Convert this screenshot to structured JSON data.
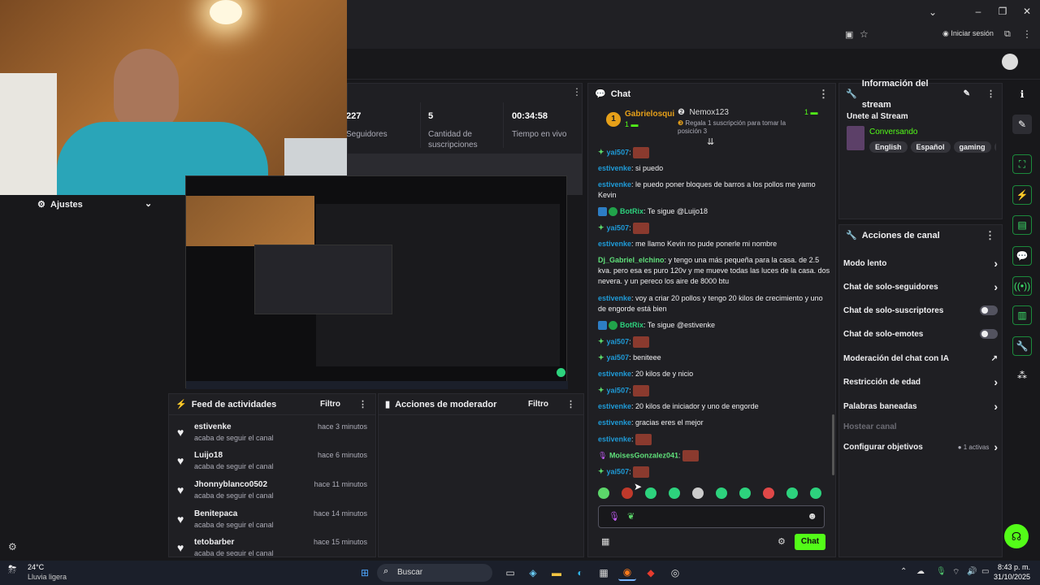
{
  "browser": {
    "signin_label": "Iniciar sesión"
  },
  "stats": [
    {
      "value": "227",
      "label": "Seguidores"
    },
    {
      "value": "5",
      "label": "Cantidad de suscripciones"
    },
    {
      "value": "00:34:58",
      "label": "Tiempo en vivo"
    }
  ],
  "left_nav": {
    "settings_label": "Ajustes"
  },
  "activity_feed": {
    "title": "Feed de actividades",
    "filter": "Filtro",
    "items": [
      {
        "user": "estivenke",
        "action": "acaba de seguir el canal",
        "time": "hace 3 minutos"
      },
      {
        "user": "Luijo18",
        "action": "acaba de seguir el canal",
        "time": "hace 6 minutos"
      },
      {
        "user": "Jhonnyblanco0502",
        "action": "acaba de seguir el canal",
        "time": "hace 11 minutos"
      },
      {
        "user": "Benitepaca",
        "action": "acaba de seguir el canal",
        "time": "hace 14 minutos"
      },
      {
        "user": "tetobarber",
        "action": "acaba de seguir el canal",
        "time": "hace 15 minutos"
      }
    ]
  },
  "mod_actions": {
    "title": "Acciones de moderador",
    "filter": "Filtro"
  },
  "chat": {
    "title": "Chat",
    "leader_name": "Gabrielosqui",
    "leader_count": "1",
    "gift_user": "Nemox123",
    "gift_text": "Regala 1 suscripción para tomar la posición 3",
    "gift_count": "1",
    "send_label": "Chat",
    "messages": [
      {
        "user": "yai507",
        "text": "",
        "color": "#1f9bd8"
      },
      {
        "user": "estivenke",
        "text": "si puedo",
        "color": "#1f9bd8"
      },
      {
        "user": "estivenke",
        "text": "le puedo poner bloques de barros a los pollos me yamo Kevin",
        "color": "#1f9bd8"
      },
      {
        "user": "BotRix",
        "text": "Te sigue @Luijo18",
        "color": "#2dd27d"
      },
      {
        "user": "yai507",
        "text": "",
        "color": "#1f9bd8"
      },
      {
        "user": "estivenke",
        "text": "me llamo Kevin no pude ponerle mi nombre",
        "color": "#1f9bd8"
      },
      {
        "user": "Dj_Gabriel_elchino",
        "text": "y tengo una más pequeña para la casa. de 2.5 kva. pero esa es puro 120v y me mueve todas las luces de la casa. dos nevera. y un pereco los aire de 8000 btu",
        "color": "#5fe07a"
      },
      {
        "user": "estivenke",
        "text": "voy a criar 20 pollos y tengo 20 kilos de crecimiento y uno de engorde está bien",
        "color": "#1f9bd8"
      },
      {
        "user": "BotRix",
        "text": "Te sigue @estivenke",
        "color": "#2dd27d"
      },
      {
        "user": "yai507",
        "text": "",
        "color": "#1f9bd8"
      },
      {
        "user": "yai507",
        "text": "beniteee",
        "color": "#1f9bd8"
      },
      {
        "user": "estivenke",
        "text": "20 kilos de y nicio",
        "color": "#1f9bd8"
      },
      {
        "user": "yai507",
        "text": "",
        "color": "#1f9bd8"
      },
      {
        "user": "estivenke",
        "text": "20 kilos de iniciador y uno de engorde",
        "color": "#1f9bd8"
      },
      {
        "user": "estivenke",
        "text": "gracias eres el mejor",
        "color": "#1f9bd8"
      },
      {
        "user": "estivenke",
        "text": "",
        "color": "#1f9bd8"
      },
      {
        "user": "MoisesGonzalez041",
        "text": "",
        "color": "#5fe07a"
      },
      {
        "user": "yai507",
        "text": "",
        "color": "#1f9bd8"
      }
    ]
  },
  "stream_info": {
    "title": "Información del stream",
    "stream_title": "Unete al Stream",
    "category": "Conversando",
    "tags": [
      "English",
      "Español",
      "gaming",
      "gra"
    ]
  },
  "channel_actions": {
    "title": "Acciones de canal",
    "items": [
      {
        "label": "Modo lento",
        "control": "arrow"
      },
      {
        "label": "Chat de solo-seguidores",
        "control": "arrow"
      },
      {
        "label": "Chat de solo-suscriptores",
        "control": "toggle"
      },
      {
        "label": "Chat de solo-emotes",
        "control": "toggle"
      },
      {
        "label": "Moderación del chat con IA",
        "control": "external"
      },
      {
        "label": "Restricción de edad",
        "control": "arrow"
      },
      {
        "label": "Palabras baneadas",
        "control": "arrow"
      },
      {
        "label": "Hostear canal",
        "control": "disabled"
      },
      {
        "label": "Configurar objetivos",
        "control": "arrow"
      }
    ],
    "goals_badge": "1 activas"
  },
  "taskbar": {
    "temp": "24°C",
    "weather": "Lluvia ligera",
    "search": "Buscar",
    "time": "8:43 p. m.",
    "date": "31/10/2025"
  },
  "colors": {
    "accent": "#53fc18",
    "bg": "#18181b",
    "panel": "#1f1f23"
  }
}
